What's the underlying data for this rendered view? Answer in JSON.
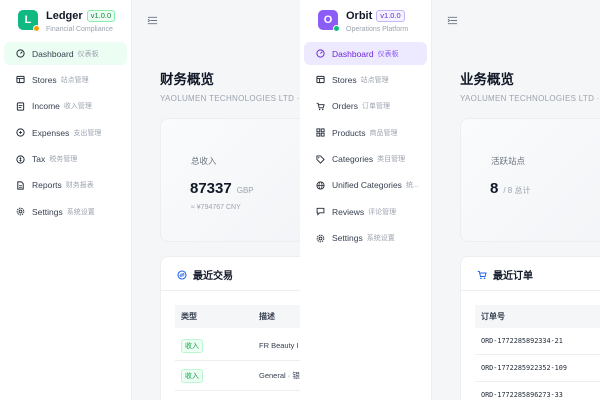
{
  "ledger": {
    "app": {
      "logo_letter": "L",
      "name": "Ledger",
      "version": "v1.0.0",
      "subtitle": "Financial Compliance",
      "accent": "#10b981"
    },
    "nav": [
      {
        "label": "Dashboard",
        "sub": "仪表板",
        "icon": "dashboard-icon",
        "active": true
      },
      {
        "label": "Stores",
        "sub": "站点管理",
        "icon": "store-icon"
      },
      {
        "label": "Income",
        "sub": "收入管理",
        "icon": "income-icon"
      },
      {
        "label": "Expenses",
        "sub": "支出管理",
        "icon": "expenses-icon"
      },
      {
        "label": "Tax",
        "sub": "税务管理",
        "icon": "tax-icon"
      },
      {
        "label": "Reports",
        "sub": "财务报表",
        "icon": "reports-icon"
      },
      {
        "label": "Settings",
        "sub": "系统设置",
        "icon": "settings-icon"
      }
    ],
    "page": {
      "title": "财务概览",
      "company": "YAOLUMEN TECHNOLOGIES LTD · 财务"
    },
    "stat": {
      "label": "总收入",
      "value": "87337",
      "unit": "GBP",
      "foot": "≈ ¥794767 CNY"
    },
    "table_card": {
      "title": "最近交易",
      "columns": [
        "类型",
        "描述"
      ],
      "rows": [
        {
          "type": "收入",
          "desc": "FR Beauty I"
        },
        {
          "type": "收入",
          "desc": "General · 银"
        }
      ]
    }
  },
  "orbit": {
    "app": {
      "logo_letter": "O",
      "name": "Orbit",
      "version": "v1.0.0",
      "subtitle": "Operations Platform",
      "accent": "#8b5cf6"
    },
    "nav": [
      {
        "label": "Dashboard",
        "sub": "仪表板",
        "icon": "dashboard-icon",
        "active": true
      },
      {
        "label": "Stores",
        "sub": "站点管理",
        "icon": "store-icon"
      },
      {
        "label": "Orders",
        "sub": "订单管理",
        "icon": "cart-icon"
      },
      {
        "label": "Products",
        "sub": "商品管理",
        "icon": "grid-icon"
      },
      {
        "label": "Categories",
        "sub": "类目管理",
        "icon": "tag-icon"
      },
      {
        "label": "Unified Categories",
        "sub": "统...",
        "icon": "globe-icon"
      },
      {
        "label": "Reviews",
        "sub": "评论管理",
        "icon": "review-icon"
      },
      {
        "label": "Settings",
        "sub": "系统设置",
        "icon": "settings-icon"
      }
    ],
    "page": {
      "title": "业务概览",
      "company": "YAOLUMEN TECHNOLOGIES LTD · 运营"
    },
    "stat": {
      "label": "活跃站点",
      "value": "8",
      "unit": "/ 8 总计"
    },
    "table_card": {
      "title": "最近订单",
      "columns": [
        "订单号"
      ],
      "rows": [
        {
          "order": "ORD-1772285892334-21"
        },
        {
          "order": "ORD-1772285922352-109"
        },
        {
          "order": "ORD-1772285896273-33"
        }
      ]
    }
  }
}
